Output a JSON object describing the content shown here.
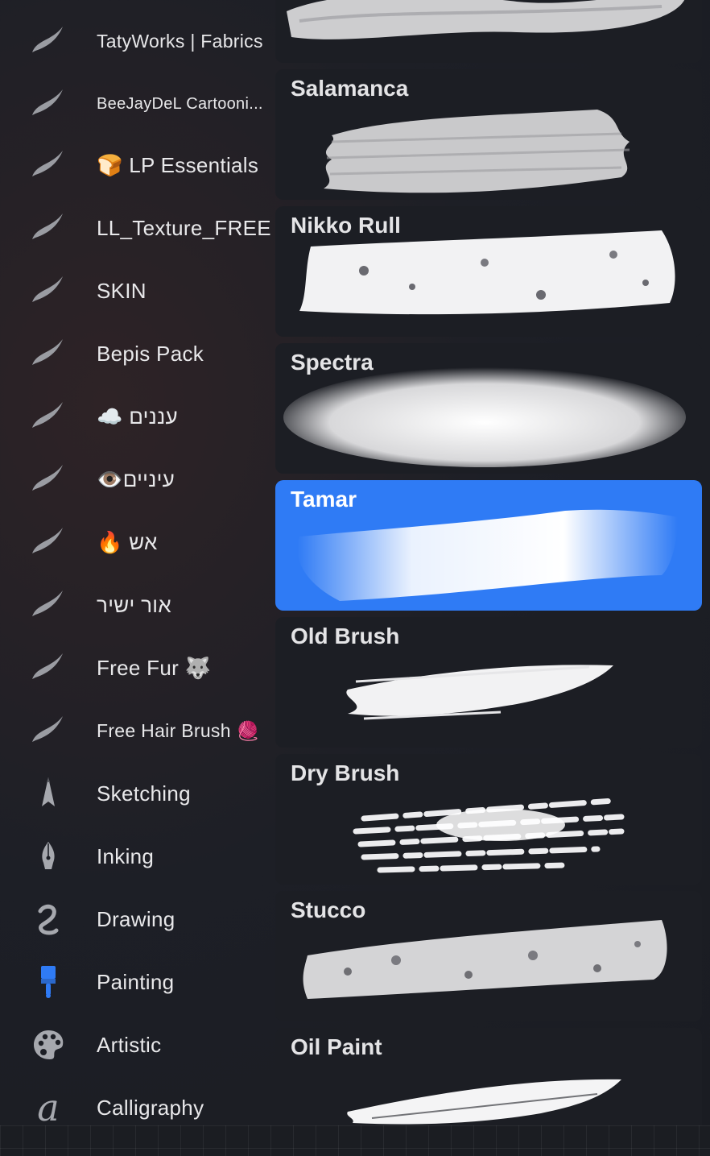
{
  "brush_sets": [
    {
      "label": "TatyWorks | Fabrics",
      "icon": "brush-stroke-icon"
    },
    {
      "label": "BeeJayDeL Cartooni...",
      "icon": "brush-stroke-icon"
    },
    {
      "label": "🍞 LP Essentials",
      "icon": "brush-stroke-icon"
    },
    {
      "label": "LL_Texture_FREE",
      "icon": "brush-stroke-icon"
    },
    {
      "label": "SKIN",
      "icon": "brush-stroke-icon"
    },
    {
      "label": "Bepis Pack",
      "icon": "brush-stroke-icon"
    },
    {
      "label": "☁️ עננים",
      "icon": "brush-stroke-icon"
    },
    {
      "label": "👁️עיניים",
      "icon": "brush-stroke-icon"
    },
    {
      "label": "🔥 אש",
      "icon": "brush-stroke-icon"
    },
    {
      "label": "אור ישיר",
      "icon": "brush-stroke-icon"
    },
    {
      "label": "Free Fur 🐺",
      "icon": "brush-stroke-icon"
    },
    {
      "label": "Free Hair Brush 🧶",
      "icon": "brush-stroke-icon"
    },
    {
      "label": "Sketching",
      "icon": "pencil-tip-icon"
    },
    {
      "label": "Inking",
      "icon": "pen-nib-icon"
    },
    {
      "label": "Drawing",
      "icon": "squiggle-icon"
    },
    {
      "label": "Painting",
      "icon": "paint-brush-icon"
    },
    {
      "label": "Artistic",
      "icon": "palette-icon"
    },
    {
      "label": "Calligraphy",
      "icon": "calligraphy-a-icon"
    }
  ],
  "brushes": [
    {
      "name": "",
      "selected": false
    },
    {
      "name": "Salamanca",
      "selected": false
    },
    {
      "name": "Nikko Rull",
      "selected": false
    },
    {
      "name": "Spectra",
      "selected": false
    },
    {
      "name": "Tamar",
      "selected": true
    },
    {
      "name": "Old Brush",
      "selected": false
    },
    {
      "name": "Dry Brush",
      "selected": false
    },
    {
      "name": "Stucco",
      "selected": false
    },
    {
      "name": "Oil Paint",
      "selected": false
    }
  ],
  "colors": {
    "accent": "#2f7bf5",
    "painting_icon": "#2f7bf5",
    "card_bg": "#1c1e24"
  }
}
